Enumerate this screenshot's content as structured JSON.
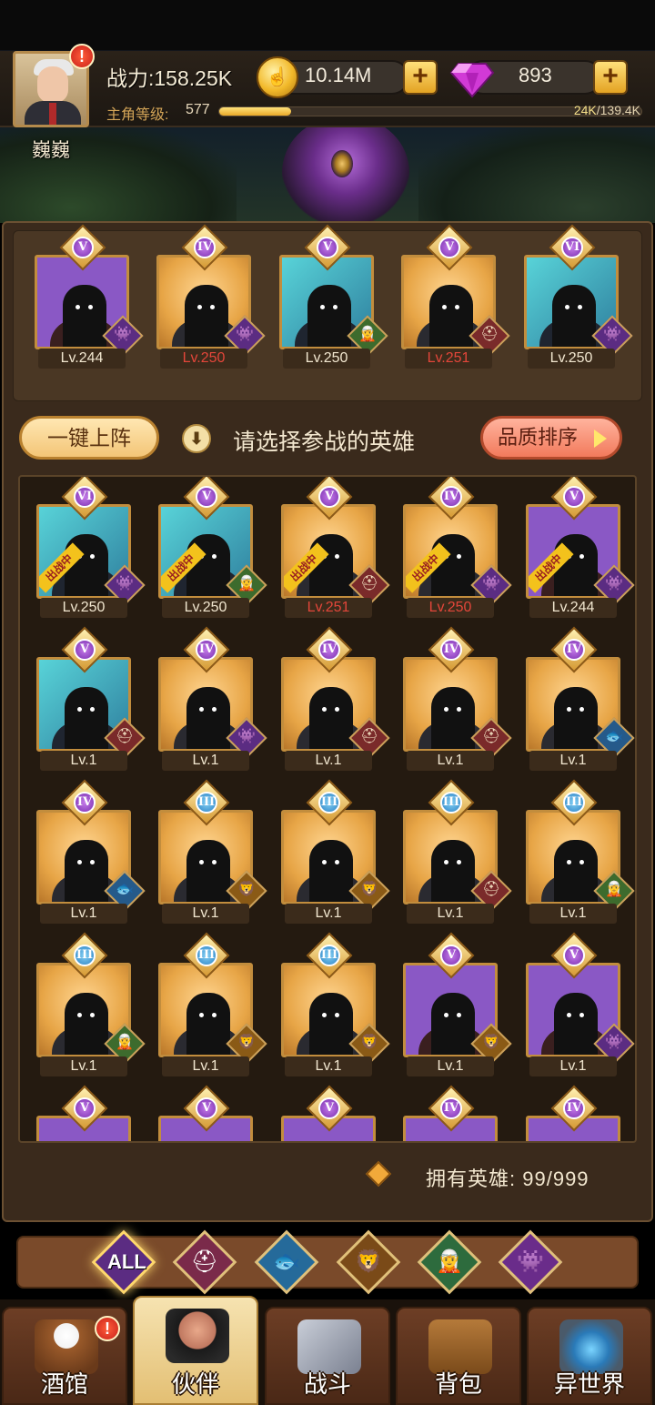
{
  "header": {
    "player_name": "巍巍",
    "power_label": "战力:158.25K",
    "level_label": "主角等级:",
    "level_value": "577",
    "xp_current": "24K",
    "xp_total": "/139.4K",
    "xp_progress": 0.17,
    "gold": "10.14M",
    "gems": "893",
    "alert": "!"
  },
  "team": [
    {
      "rank": "V",
      "level": "Lv.244",
      "quality": "purple",
      "red": false,
      "faction": "demon"
    },
    {
      "rank": "IV",
      "level": "Lv.250",
      "quality": "gold",
      "red": true,
      "faction": "demon"
    },
    {
      "rank": "V",
      "level": "Lv.250",
      "quality": "cyan",
      "red": false,
      "faction": "elf"
    },
    {
      "rank": "V",
      "level": "Lv.251",
      "quality": "gold",
      "red": true,
      "faction": "human"
    },
    {
      "rank": "VI",
      "level": "Lv.250",
      "quality": "cyan",
      "red": false,
      "faction": "demon"
    }
  ],
  "controls": {
    "one_click": "一键上阵",
    "hint": "请选择参战的英雄",
    "sort": "品质排序",
    "info": "!"
  },
  "roster": [
    {
      "rank": "VI",
      "level": "Lv.250",
      "quality": "cyan",
      "deployed": true,
      "red": false,
      "faction": "demon"
    },
    {
      "rank": "V",
      "level": "Lv.250",
      "quality": "cyan",
      "deployed": true,
      "red": false,
      "faction": "elf"
    },
    {
      "rank": "V",
      "level": "Lv.251",
      "quality": "gold",
      "deployed": true,
      "red": true,
      "faction": "human"
    },
    {
      "rank": "IV",
      "level": "Lv.250",
      "quality": "gold",
      "deployed": true,
      "red": true,
      "faction": "demon"
    },
    {
      "rank": "V",
      "level": "Lv.244",
      "quality": "purple",
      "deployed": true,
      "red": false,
      "faction": "demon"
    },
    {
      "rank": "V",
      "level": "Lv.1",
      "quality": "cyan",
      "deployed": false,
      "red": false,
      "faction": "human"
    },
    {
      "rank": "IV",
      "level": "Lv.1",
      "quality": "gold",
      "deployed": false,
      "red": false,
      "faction": "demon"
    },
    {
      "rank": "IV",
      "level": "Lv.1",
      "quality": "gold",
      "deployed": false,
      "red": false,
      "faction": "human"
    },
    {
      "rank": "IV",
      "level": "Lv.1",
      "quality": "gold",
      "deployed": false,
      "red": false,
      "faction": "human"
    },
    {
      "rank": "IV",
      "level": "Lv.1",
      "quality": "gold",
      "deployed": false,
      "red": false,
      "faction": "sea"
    },
    {
      "rank": "IV",
      "level": "Lv.1",
      "quality": "gold",
      "deployed": false,
      "red": false,
      "faction": "sea"
    },
    {
      "rank": "III",
      "level": "Lv.1",
      "quality": "gold",
      "deployed": false,
      "red": false,
      "faction": "beast"
    },
    {
      "rank": "III",
      "level": "Lv.1",
      "quality": "gold",
      "deployed": false,
      "red": false,
      "faction": "beast"
    },
    {
      "rank": "III",
      "level": "Lv.1",
      "quality": "gold",
      "deployed": false,
      "red": false,
      "faction": "human"
    },
    {
      "rank": "III",
      "level": "Lv.1",
      "quality": "gold",
      "deployed": false,
      "red": false,
      "faction": "elf"
    },
    {
      "rank": "III",
      "level": "Lv.1",
      "quality": "gold",
      "deployed": false,
      "red": false,
      "faction": "elf"
    },
    {
      "rank": "III",
      "level": "Lv.1",
      "quality": "gold",
      "deployed": false,
      "red": false,
      "faction": "beast"
    },
    {
      "rank": "III",
      "level": "Lv.1",
      "quality": "gold",
      "deployed": false,
      "red": false,
      "faction": "beast"
    },
    {
      "rank": "V",
      "level": "Lv.1",
      "quality": "purple",
      "deployed": false,
      "red": false,
      "faction": "beast"
    },
    {
      "rank": "V",
      "level": "Lv.1",
      "quality": "purple",
      "deployed": false,
      "red": false,
      "faction": "demon"
    },
    {
      "rank": "V",
      "level": "",
      "quality": "purple",
      "deployed": false,
      "red": false,
      "faction": ""
    },
    {
      "rank": "V",
      "level": "",
      "quality": "purple",
      "deployed": false,
      "red": false,
      "faction": ""
    },
    {
      "rank": "V",
      "level": "",
      "quality": "purple",
      "deployed": false,
      "red": false,
      "faction": ""
    },
    {
      "rank": "IV",
      "level": "",
      "quality": "purple",
      "deployed": false,
      "red": false,
      "faction": ""
    },
    {
      "rank": "IV",
      "level": "",
      "quality": "purple",
      "deployed": false,
      "red": false,
      "faction": ""
    }
  ],
  "deployed_tag": "出战中",
  "owned": {
    "label": "拥有英雄:",
    "value": "99/999"
  },
  "filters": [
    {
      "label": "ALL",
      "icon": "all",
      "active": true
    },
    {
      "label": "",
      "icon": "human-icon",
      "active": false
    },
    {
      "label": "",
      "icon": "sea-icon",
      "active": false
    },
    {
      "label": "",
      "icon": "beast-icon",
      "active": false
    },
    {
      "label": "",
      "icon": "elf-icon",
      "active": false
    },
    {
      "label": "",
      "icon": "demon-icon",
      "active": false
    }
  ],
  "nav": [
    {
      "label": "酒馆",
      "icon": "tavern-icon",
      "active": false,
      "alert": "!"
    },
    {
      "label": "伙伴",
      "icon": "partner-icon",
      "active": true,
      "alert": ""
    },
    {
      "label": "战斗",
      "icon": "battle-icon",
      "active": false,
      "alert": ""
    },
    {
      "label": "背包",
      "icon": "backpack-icon",
      "active": false,
      "alert": ""
    },
    {
      "label": "异世界",
      "icon": "otherworld-icon",
      "active": false,
      "alert": ""
    }
  ],
  "colors": {
    "gold_frame": "#c28d3d",
    "purple": "#8a58c5",
    "cyan": "#58d3d8",
    "red_level": "#e3463a",
    "accent": "#f3c21c"
  }
}
